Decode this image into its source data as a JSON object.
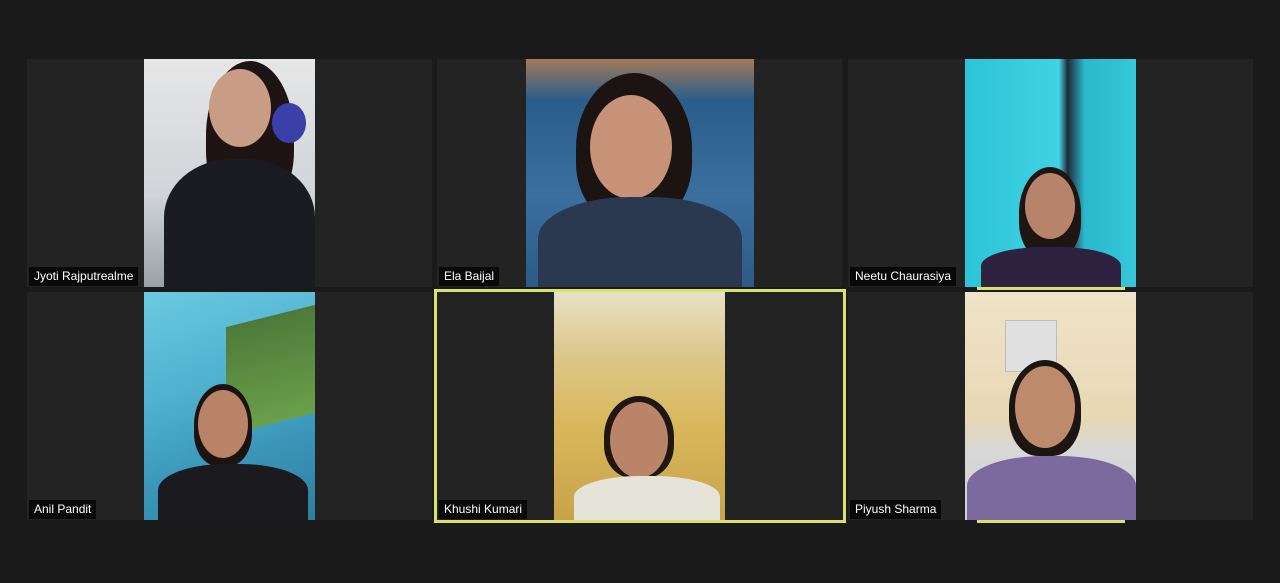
{
  "meeting": {
    "participants": [
      {
        "name": "Jyoti Rajputrealme",
        "speaking": false
      },
      {
        "name": "Ela Baijal",
        "speaking": false
      },
      {
        "name": "Neetu Chaurasiya",
        "speaking": true
      },
      {
        "name": "Anil Pandit",
        "speaking": false
      },
      {
        "name": "Khushi Kumari",
        "speaking": true,
        "active_speaker": true
      },
      {
        "name": "Piyush Sharma",
        "speaking": true
      }
    ]
  },
  "colors": {
    "background": "#1a1a1a",
    "tile": "#232323",
    "active_border": "#d9e36a",
    "label_bg": "#000000",
    "label_text": "#ffffff"
  }
}
